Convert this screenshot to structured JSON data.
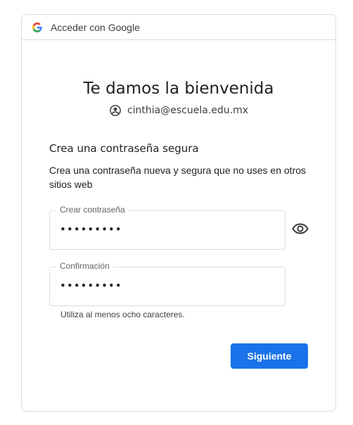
{
  "header": {
    "title": "Acceder con Google",
    "logo_icon": "google-g-icon"
  },
  "welcome": {
    "title": "Te damos la bienvenida",
    "account_icon": "account-circle-icon",
    "email": "cinthia@escuela.edu.mx"
  },
  "section": {
    "title": "Crea una contraseña segura",
    "description": "Crea una contraseña nueva y segura que no uses en otros sitios web"
  },
  "fields": {
    "password": {
      "label": "Crear contraseña",
      "value": "•••••••••"
    },
    "confirm": {
      "label": "Confirmación",
      "value": "•••••••••"
    },
    "toggle_visibility_icon": "eye-icon"
  },
  "hint": "Utiliza al menos ocho caracteres.",
  "actions": {
    "next_label": "Siguiente"
  },
  "colors": {
    "primary": "#1a73e8",
    "border": "#dadce0"
  }
}
